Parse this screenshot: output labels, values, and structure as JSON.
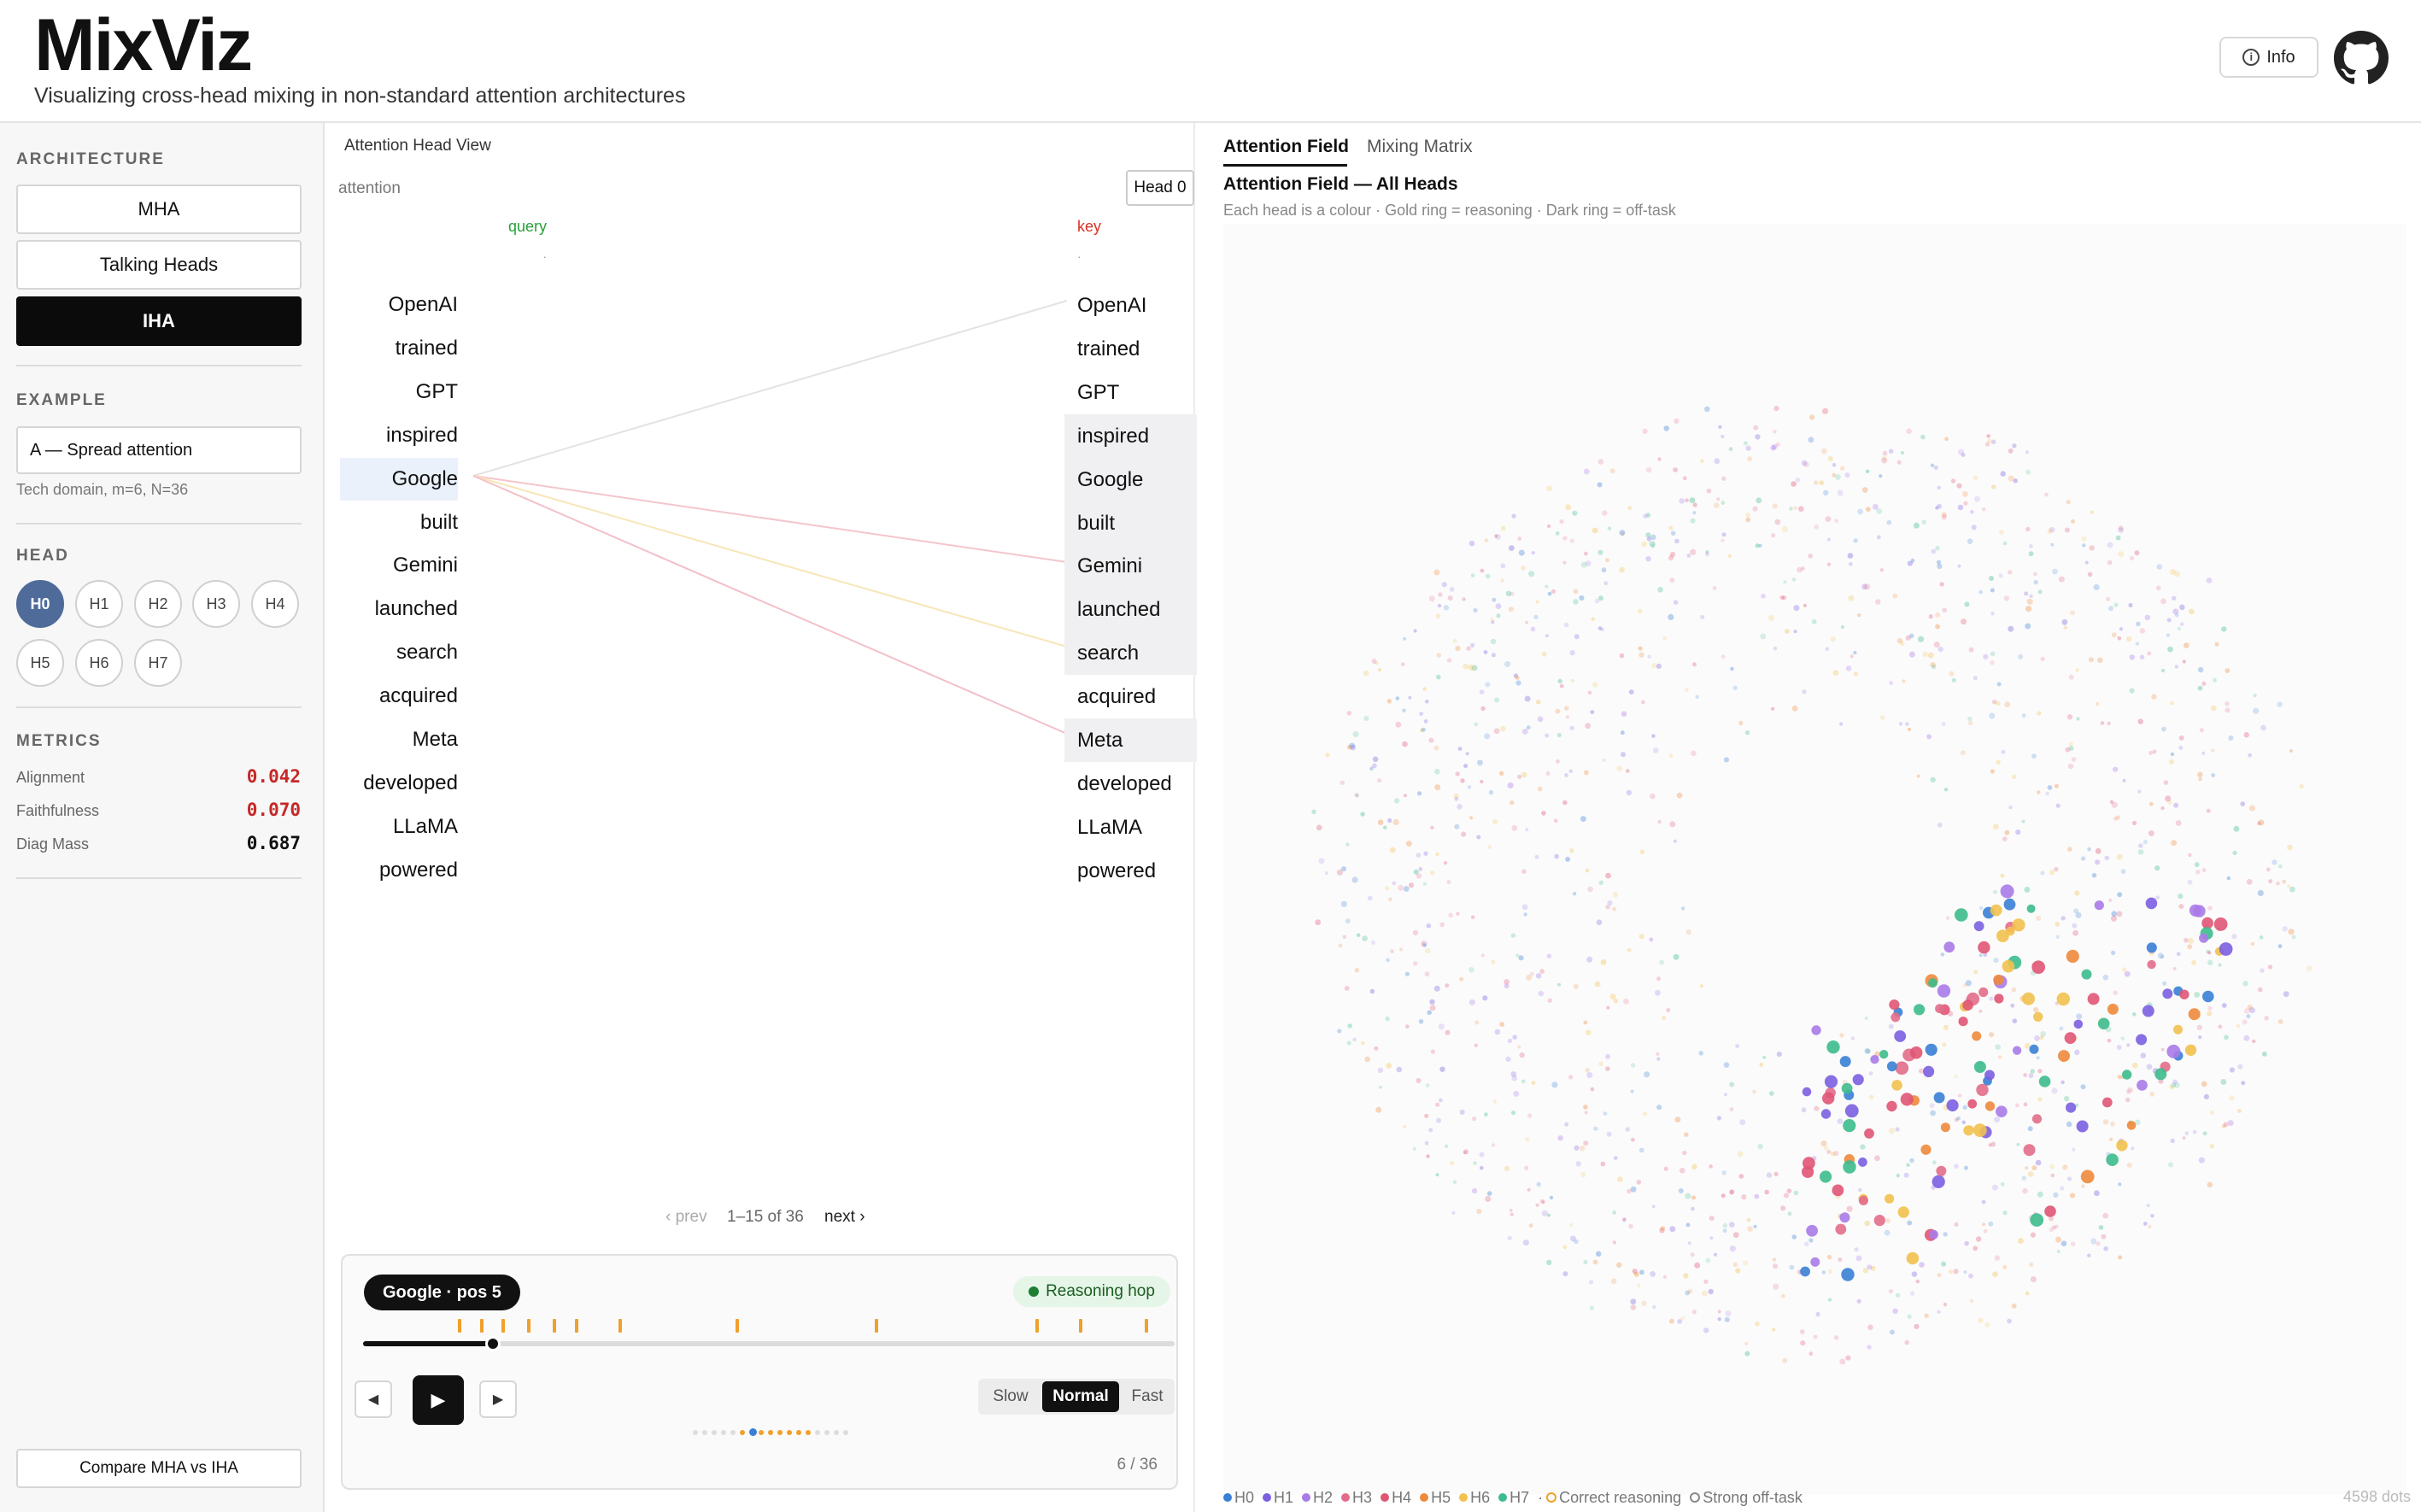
{
  "header": {
    "logo": "MixViz",
    "subtitle": "Visualizing cross-head mixing in non-standard attention architectures",
    "info_label": "Info"
  },
  "sidebar": {
    "architecture_label": "ARCHITECTURE",
    "architectures": [
      "MHA",
      "Talking Heads",
      "IHA"
    ],
    "active_architecture": "IHA",
    "example_label": "EXAMPLE",
    "example_value": "A — Spread attention",
    "example_meta": "Tech domain, m=6, N=36",
    "head_label": "HEAD",
    "heads": [
      "H0",
      "H1",
      "H2",
      "H3",
      "H4",
      "H5",
      "H6",
      "H7"
    ],
    "active_head": "H0",
    "metrics_label": "METRICS",
    "metrics": [
      {
        "name": "Alignment",
        "value": "0.042",
        "color": "#c62828"
      },
      {
        "name": "Faithfulness",
        "value": "0.070",
        "color": "#c62828"
      },
      {
        "name": "Diag Mass",
        "value": "0.687",
        "color": "#111111"
      }
    ],
    "compare_label": "Compare MHA vs IHA"
  },
  "head_view": {
    "title": "Attention Head View",
    "mode_label": "attention",
    "head_chip": "Head 0",
    "query_label": "query",
    "key_label": "key",
    "dot_token": "·",
    "tokens": [
      "OpenAI",
      "trained",
      "GPT",
      "inspired",
      "Google",
      "built",
      "Gemini",
      "launched",
      "search",
      "acquired",
      "Meta",
      "developed",
      "LLaMA",
      "powered"
    ],
    "selected_query": "Google",
    "highlighted_keys": [
      "inspired",
      "Google",
      "built",
      "Gemini",
      "launched",
      "search",
      "Meta"
    ],
    "pager": {
      "prev": "‹ prev",
      "range": "1–15 of 36",
      "next": "next ›"
    }
  },
  "player": {
    "token_chip": "Google · pos 5",
    "hop_badge": "Reasoning hop",
    "progress": 0.16,
    "speeds": [
      "Slow",
      "Normal",
      "Fast"
    ],
    "active_speed": "Normal",
    "step_count": "6 / 36",
    "play_icon": "play-icon",
    "prev_icon": "step-back-icon",
    "next_icon": "step-forward-icon"
  },
  "right_panel": {
    "tabs": [
      "Attention Field",
      "Mixing Matrix"
    ],
    "active_tab": "Attention Field",
    "field_title": "Attention Field — All Heads",
    "field_subtitle": "Each head is a colour · Gold ring = reasoning · Dark ring = off-task",
    "legend": [
      {
        "label": "H0",
        "color": "#3a7fd5"
      },
      {
        "label": "H1",
        "color": "#7b5fe0"
      },
      {
        "label": "H2",
        "color": "#a87be8"
      },
      {
        "label": "H3",
        "color": "#e26d8a"
      },
      {
        "label": "H4",
        "color": "#e05574"
      },
      {
        "label": "H5",
        "color": "#ee8a3c"
      },
      {
        "label": "H6",
        "color": "#f2c14e"
      },
      {
        "label": "H7",
        "color": "#3dbb8c"
      }
    ],
    "legend_sep": "·",
    "legend_correct": "Correct reasoning",
    "legend_offtask": "Strong off-task",
    "dot_count": "4598 dots"
  }
}
